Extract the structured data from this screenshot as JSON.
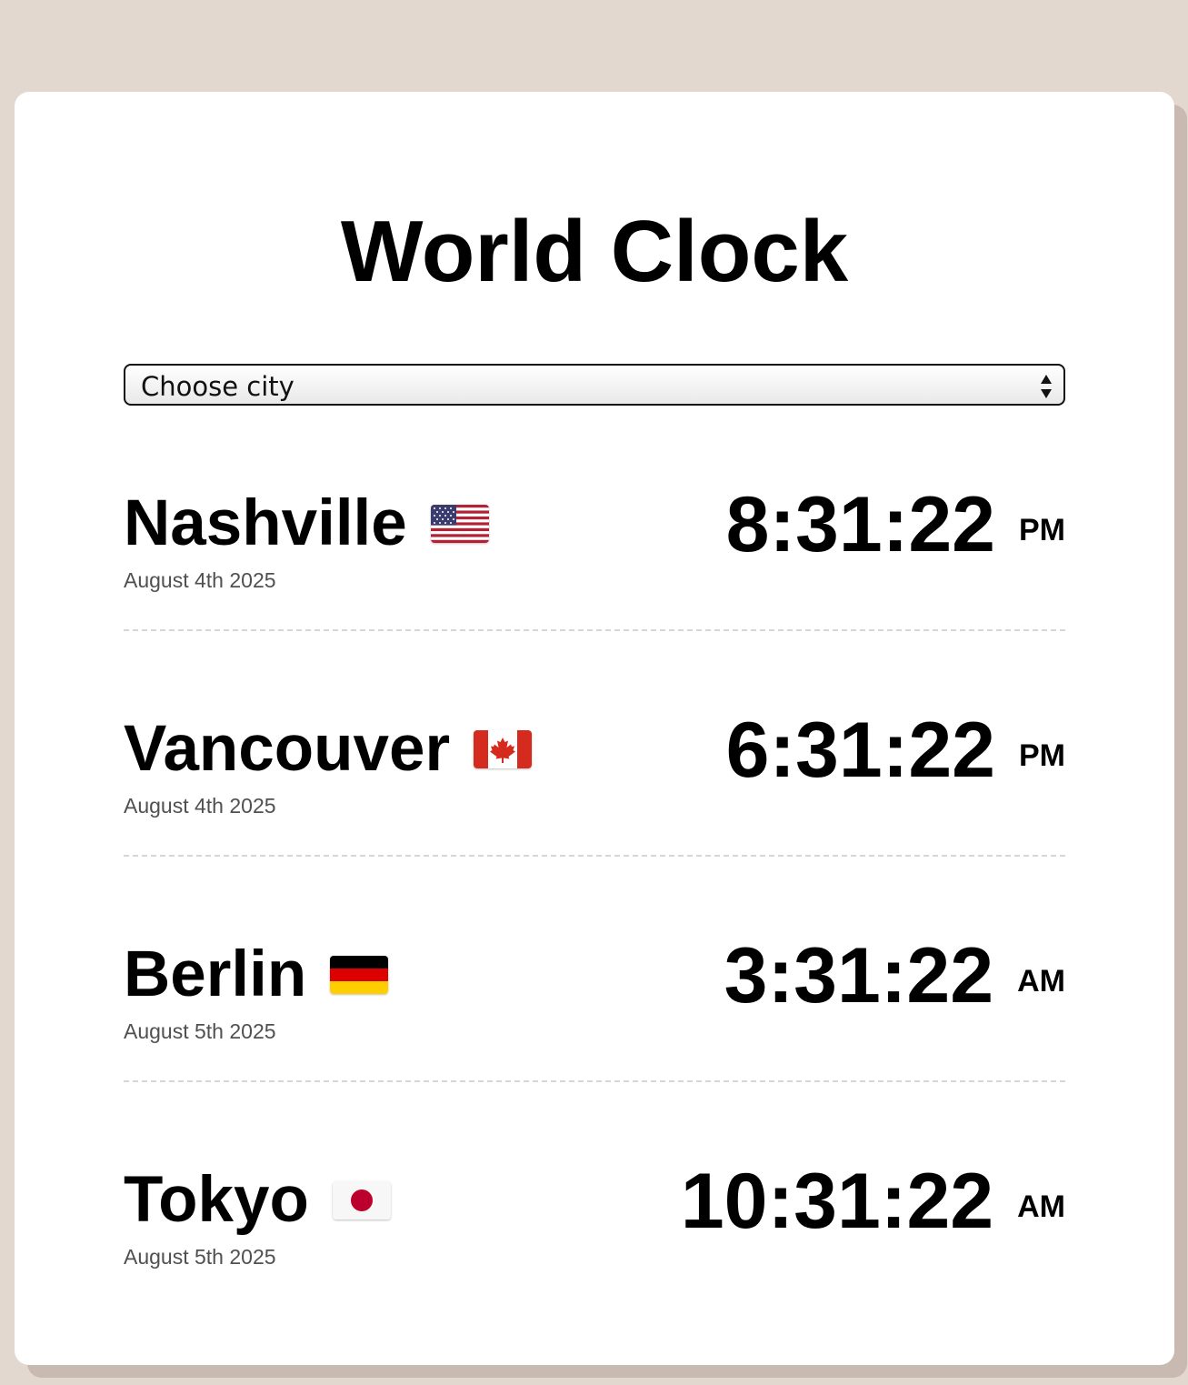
{
  "app": {
    "title": "World Clock"
  },
  "city_select": {
    "selected_label": "Choose city"
  },
  "cities": [
    {
      "name": "Nashville",
      "flag": "us-flag-icon",
      "date": "August 4th 2025",
      "time": "8:31:22",
      "ampm": "PM"
    },
    {
      "name": "Vancouver",
      "flag": "canada-flag-icon",
      "date": "August 4th 2025",
      "time": "6:31:22",
      "ampm": "PM"
    },
    {
      "name": "Berlin",
      "flag": "germany-flag-icon",
      "date": "August 5th 2025",
      "time": "3:31:22",
      "ampm": "AM"
    },
    {
      "name": "Tokyo",
      "flag": "japan-flag-icon",
      "date": "August 5th 2025",
      "time": "10:31:22",
      "ampm": "AM"
    }
  ],
  "colors": {
    "page_background": "#e3d8d0",
    "card_background": "#ffffff",
    "card_shadow": "#c8b9b1",
    "divider": "#d6d6d6",
    "date_text": "#505050"
  }
}
